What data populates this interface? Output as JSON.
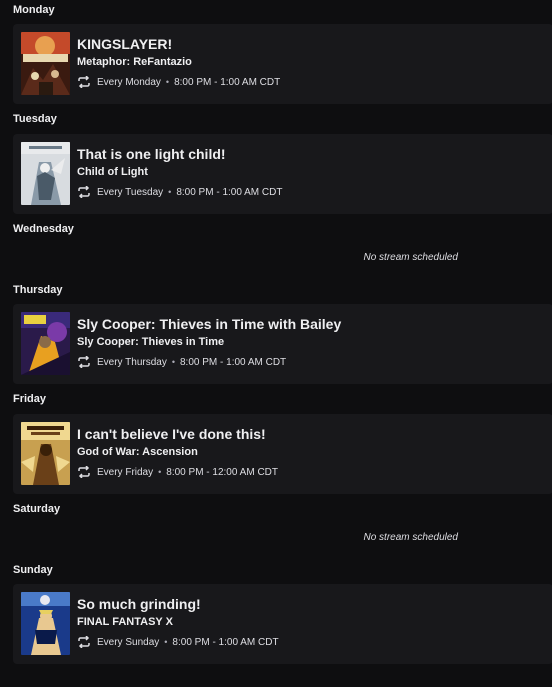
{
  "days": [
    {
      "label": "Monday",
      "stream": {
        "title": "KINGSLAYER!",
        "game": "Metaphor: ReFantazio",
        "recurrence": "Every Monday",
        "time": "8:00 PM - 1:00 AM CDT",
        "art_colors": [
          "#5a2a1a",
          "#c44a2a",
          "#e8d8b0",
          "#2a1a10"
        ]
      }
    },
    {
      "label": "Tuesday",
      "stream": {
        "title": "That is one light child!",
        "game": "Child of Light",
        "recurrence": "Every Tuesday",
        "time": "8:00 PM - 1:00 AM CDT",
        "art_colors": [
          "#d8dce0",
          "#8a9aa8",
          "#4a5a68",
          "#f0f0f0"
        ]
      }
    },
    {
      "label": "Wednesday",
      "empty_text": "No stream scheduled"
    },
    {
      "label": "Thursday",
      "stream": {
        "title": "Sly Cooper: Thieves in Time with Bailey",
        "game": "Sly Cooper: Thieves in Time",
        "recurrence": "Every Thursday",
        "time": "8:00 PM - 1:00 AM CDT",
        "art_colors": [
          "#2a1a4a",
          "#7a3aa8",
          "#e8a020",
          "#1a1030"
        ]
      }
    },
    {
      "label": "Friday",
      "stream": {
        "title": "I can't believe I've done this!",
        "game": "God of War: Ascension",
        "recurrence": "Every Friday",
        "time": "8:00 PM - 12:00 AM CDT",
        "art_colors": [
          "#c8a050",
          "#6a4018",
          "#f0d890",
          "#3a2008"
        ]
      }
    },
    {
      "label": "Saturday",
      "empty_text": "No stream scheduled"
    },
    {
      "label": "Sunday",
      "stream": {
        "title": "So much grinding!",
        "game": "FINAL FANTASY X",
        "recurrence": "Every Sunday",
        "time": "8:00 PM - 1:00 AM CDT",
        "art_colors": [
          "#1a3a8a",
          "#4a7ac8",
          "#e8c890",
          "#0a1a4a"
        ]
      }
    }
  ]
}
